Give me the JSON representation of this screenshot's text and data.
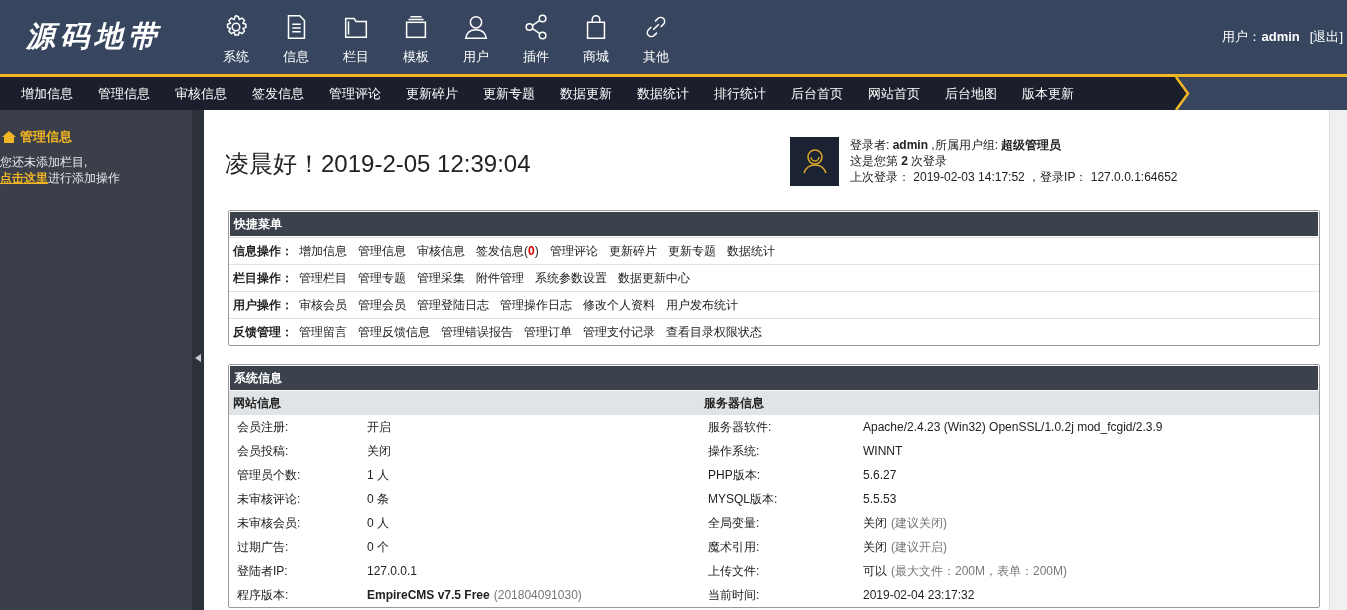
{
  "logo": "源码地带",
  "top_nav": [
    {
      "label": "系统"
    },
    {
      "label": "信息"
    },
    {
      "label": "栏目"
    },
    {
      "label": "模板"
    },
    {
      "label": "用户"
    },
    {
      "label": "插件"
    },
    {
      "label": "商城"
    },
    {
      "label": "其他"
    }
  ],
  "user_bar": {
    "label": "用户：",
    "user": "admin",
    "logout": "[退出]"
  },
  "sub_nav": [
    "增加信息",
    "管理信息",
    "审核信息",
    "签发信息",
    "管理评论",
    "更新碎片",
    "更新专题",
    "数据更新",
    "数据统计",
    "排行统计",
    "后台首页",
    "网站首页",
    "后台地图",
    "版本更新"
  ],
  "sidebar": {
    "title": "管理信息",
    "notice": "您还未添加栏目,",
    "link": "点击这里",
    "rest": "进行添加操作"
  },
  "greeting": "凌晨好！2019-2-05 12:39:04",
  "login_info": [
    "登录者: **admin** ,所属用户组: **超级管理员**",
    "这是您第 **2** 次登录",
    "上次登录： 2019-02-03 14:17:52 ，登录IP： 127.0.0.1:64652"
  ],
  "quick_menu": {
    "title": "快捷菜单",
    "rows": [
      {
        "label": "信息操作：",
        "links": [
          {
            "text": "增加信息"
          },
          {
            "text": "管理信息"
          },
          {
            "text": "审核信息"
          },
          {
            "text": "签发信息",
            "count": "(**0**)"
          },
          {
            "text": "管理评论"
          },
          {
            "text": "更新碎片"
          },
          {
            "text": "更新专题"
          },
          {
            "text": "数据统计"
          }
        ]
      },
      {
        "label": "栏目操作：",
        "links": [
          {
            "text": "管理栏目"
          },
          {
            "text": "管理专题"
          },
          {
            "text": "管理采集"
          },
          {
            "text": "附件管理"
          },
          {
            "text": "系统参数设置"
          },
          {
            "text": "数据更新中心"
          }
        ]
      },
      {
        "label": "用户操作：",
        "links": [
          {
            "text": "审核会员"
          },
          {
            "text": "管理会员"
          },
          {
            "text": "管理登陆日志"
          },
          {
            "text": "管理操作日志"
          },
          {
            "text": "修改个人资料"
          },
          {
            "text": "用户发布统计"
          }
        ]
      },
      {
        "label": "反馈管理：",
        "links": [
          {
            "text": "管理留言"
          },
          {
            "text": "管理反馈信息"
          },
          {
            "text": "管理错误报告"
          },
          {
            "text": "管理订单"
          },
          {
            "text": "管理支付记录"
          },
          {
            "text": "查看目录权限状态"
          }
        ]
      }
    ]
  },
  "system_info": {
    "title": "系统信息",
    "columns": [
      {
        "title": "网站信息",
        "rows": [
          {
            "label": "会员注册:",
            "value": "开启"
          },
          {
            "label": "会员投稿:",
            "value": "关闭"
          },
          {
            "label": "管理员个数:",
            "value": "1 人"
          },
          {
            "label": "未审核评论:",
            "value": "0 条"
          },
          {
            "label": "未审核会员:",
            "value": "0 人"
          },
          {
            "label": "过期广告:",
            "value": "0 个"
          },
          {
            "label": "登陆者IP:",
            "value": "127.0.0.1"
          },
          {
            "label": "程序版本:",
            "value": "**EmpireCMS v7.5 Free**",
            "note": "(201804091030)"
          }
        ]
      },
      {
        "title": "服务器信息",
        "rows": [
          {
            "label": "服务器软件:",
            "value": "Apache/2.4.23 (Win32) OpenSSL/1.0.2j mod_fcgid/2.3.9"
          },
          {
            "label": "操作系统:",
            "value": "WINNT"
          },
          {
            "label": "PHP版本:",
            "value": "5.6.27"
          },
          {
            "label": "MYSQL版本:",
            "value": "5.5.53"
          },
          {
            "label": "全局变量:",
            "value": "关闭",
            "note": "(建议关闭)"
          },
          {
            "label": "魔术引用:",
            "value": "关闭",
            "note": "(建议开启)"
          },
          {
            "label": "上传文件:",
            "value": "可以",
            "note": "(最大文件：200M，表单：200M)"
          },
          {
            "label": "当前时间:",
            "value": "2019-02-04 23:17:32"
          }
        ]
      }
    ]
  }
}
